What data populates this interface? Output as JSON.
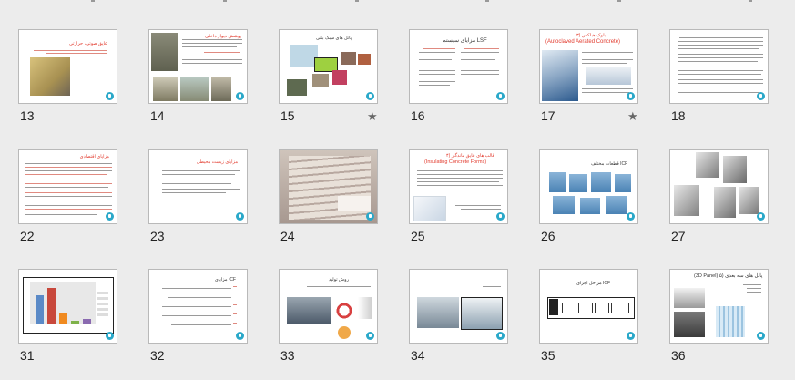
{
  "slides": [
    {
      "number": "13",
      "starred": false,
      "title": "عایق صوتی، حرارتی",
      "variant": "photo-wall"
    },
    {
      "number": "14",
      "starred": false,
      "title": "پوشش دیوار داخلی",
      "variant": "photos-text"
    },
    {
      "number": "15",
      "starred": true,
      "title": "پانل های سبک بتنی",
      "variant": "diagram"
    },
    {
      "number": "16",
      "starred": false,
      "title": "مزایای سیستم LSF",
      "variant": "two-col"
    },
    {
      "number": "17",
      "starred": true,
      "title": "(Autoclaved Aerated Concrete)",
      "subtitle": "۳) بلوک هبلکس",
      "variant": "aac"
    },
    {
      "number": "18",
      "starred": false,
      "title": "",
      "variant": "text-only"
    },
    {
      "number": "22",
      "starred": false,
      "title": "مزایای اقتصادی",
      "variant": "red-text"
    },
    {
      "number": "23",
      "starred": false,
      "title": "مزایای زیست محیطی",
      "variant": "text-light"
    },
    {
      "number": "24",
      "starred": false,
      "title": "",
      "variant": "photo-full"
    },
    {
      "number": "25",
      "starred": false,
      "title": "(Insulating Concrete Forms)",
      "subtitle": "۴) قالب های عایق ماندگار",
      "variant": "icf"
    },
    {
      "number": "26",
      "starred": false,
      "title": "قطعات مختلف ICF",
      "variant": "blocks"
    },
    {
      "number": "27",
      "starred": false,
      "title": "",
      "variant": "sculpt"
    },
    {
      "number": "31",
      "starred": false,
      "title": "",
      "variant": "chart"
    },
    {
      "number": "32",
      "starred": false,
      "title": "مزایای ICF",
      "variant": "bullets"
    },
    {
      "number": "33",
      "starred": false,
      "title": "روش تولید",
      "variant": "factory"
    },
    {
      "number": "34",
      "starred": false,
      "title": "",
      "variant": "machine"
    },
    {
      "number": "35",
      "starred": false,
      "title": "مراحل اجرای ICF",
      "variant": "flow"
    },
    {
      "number": "36",
      "starred": false,
      "title": "(3D Panel) ۵) پانل های سه بعدی",
      "variant": "panel3d"
    }
  ],
  "colors": {
    "background": "#ececec",
    "accent": "#e23b2e",
    "logo": "#2aa8c9"
  }
}
